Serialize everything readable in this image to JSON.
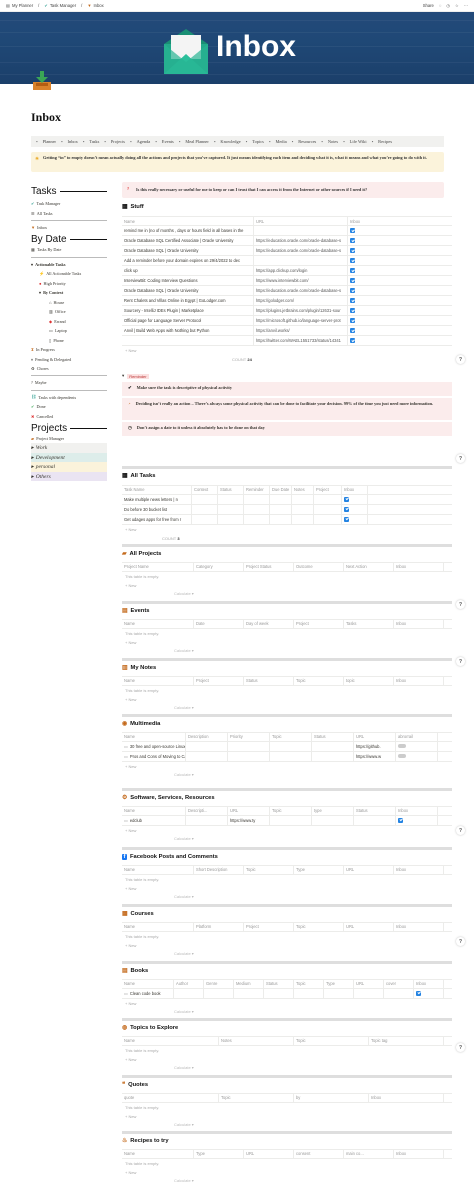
{
  "browser": {
    "crumbs": [
      "My Planner",
      "Task Manager",
      "Inbox"
    ],
    "share": "Share"
  },
  "page": {
    "title": "Inbox"
  },
  "nav": [
    "Planner",
    "Inbox",
    "Tasks",
    "Projects",
    "Agenda",
    "Events",
    "Meal Planner",
    "Knowledge",
    "Topics",
    "Media",
    "Resources",
    "Notes",
    "Life Wiki",
    "Recipes"
  ],
  "callout_top": "Getting “in” to empty doesn’t mean actually doing all the actions and projects that you’ve captured. It just means identifying each item and deciding what it is, what it means and what you’re going to do with it.",
  "callout_q": "Is this really necessary or useful for me to keep or can I trust that I can access it from the Internet or other sources if I need it?",
  "sidebar": {
    "tasks_h": "Tasks",
    "task_manager": "Task Manager",
    "all_tasks": "All Tasks",
    "inbox": "Inbox",
    "bydate_h": "By Date",
    "tasks_by_date": "Tasks By Date",
    "actionable": "Actionable Tasks",
    "all_actionable": "All Actionable Tasks",
    "high": "High Priority",
    "by_context": "By Context",
    "contexts": [
      "House",
      "Office",
      "Errand",
      "Laptop",
      "Phone"
    ],
    "in_progress": "In Progress",
    "pending": "Pending & Delegated",
    "chores": "Chores",
    "maybe": "Maybe",
    "deps": "Tasks with dependents",
    "done": "Done",
    "cancelled": "Cancelled",
    "projects_h": "Projects",
    "project_manager": "Project Manager",
    "areas": [
      "Work",
      "Development",
      "personal",
      "Others"
    ]
  },
  "stuff": {
    "title": "Stuff",
    "cols": [
      "Name",
      "URL",
      "Inbox"
    ],
    "rows": [
      [
        "remind me in (no of months , days or hours field in all bases in the",
        ""
      ],
      [
        "Oracle Database SQL Certified Associate | Oracle University",
        "https://education.oracle.com/oracle-database-s"
      ],
      [
        "Oracle Database SQL | Oracle University",
        "https://education.oracle.com/oracle-database-s"
      ],
      [
        "Add a reminder before your domain expires on 29/4/2022 to dec",
        ""
      ],
      [
        "click up",
        "https://app.clickup.com/login"
      ],
      [
        "InterviewBit: Coding Interview Questions",
        "https://www.interviewbit.com/"
      ],
      [
        "Oracle Database SQL | Oracle University",
        "https://education.oracle.com/oracle-database-s"
      ],
      [
        "Rent Chalets and Villas Online in Egypt | GoLodger.com",
        "https://golodger.com/"
      ],
      [
        "Sourcery - IntelliJ IDEs Plugin | Marketplace",
        "https://plugins.jetbrains.com/plugin/12631-sour"
      ],
      [
        "Official page for Language Server Protocol",
        "https://microsoft.github.io/language-server-prot"
      ],
      [
        "Anvil | Build Web Apps with Nothing but Python",
        "https://anvil.works/"
      ],
      [
        "",
        "https://twitter.com/WAEL1551733/status/14341"
      ]
    ],
    "count_label": "COUNT",
    "count": "24"
  },
  "reminder": {
    "tag": "Reminder",
    "items": [
      "Make sure the task is descriptive of physical activity",
      "Deciding isn’t really an action – There’s always some physical activity that can be done to facilitate your decision. 99% of the time you just need more information.",
      "Don’t assign a date to it unless it absolutely has to be done on that day"
    ]
  },
  "all_tasks": {
    "title": "All Tasks",
    "cols": [
      "Task Name",
      "Context",
      "Status",
      "Reminder",
      "Due Date",
      "Notes",
      "Project",
      "Inbox"
    ],
    "rows": [
      "Make multiple news letters | n",
      "Do before 30 bucket list",
      "Get udages apps for free from r"
    ],
    "count_label": "COUNT",
    "count": "3"
  },
  "empty": "This table is empty.",
  "new": "+ New",
  "calc": "Calculate ▾",
  "tables": [
    {
      "title": "All Projects",
      "cols": [
        "Project Name",
        "Category",
        "Project Status",
        "Outcome",
        "Next Action",
        "Inbox"
      ],
      "rows": []
    },
    {
      "title": "Events",
      "cols": [
        "Name",
        "Date",
        "Day of week",
        "Project",
        "Tasks",
        "Inbox"
      ],
      "rows": []
    },
    {
      "title": "My Notes",
      "cols": [
        "Name",
        "Project",
        "Status",
        "Topic",
        "topic",
        "Inbox"
      ],
      "rows": []
    },
    {
      "title": "Multimedia",
      "cols": [
        "Name",
        "Description",
        "Priority",
        "Topic",
        "Status",
        "URL",
        "abrorrail"
      ],
      "rows": [
        [
          "30 free and open-source Linux games - part 1 | Tr",
          "https://github."
        ],
        [
          "Pros and Cons of Moving to Calgary - How to Do",
          "https://www.w"
        ]
      ]
    },
    {
      "title": "Software, Services, Resources",
      "cols": [
        "Name",
        "Descripti...",
        "URL",
        "Topic",
        "type",
        "Status",
        "Inbox"
      ],
      "rows": [
        [
          "edclub",
          "https://www.ty"
        ]
      ]
    },
    {
      "title": "Facebook Posts and Comments",
      "cols": [
        "Name",
        "Short Description",
        "Topic",
        "Type",
        "URL",
        "Inbox"
      ],
      "rows": []
    },
    {
      "title": "Courses",
      "cols": [
        "Name",
        "Platform",
        "Project",
        "Topic",
        "URL",
        "Inbox"
      ],
      "rows": []
    },
    {
      "title": "Books",
      "cols": [
        "Name",
        "Author",
        "Genre",
        "Medium",
        "Status",
        "Topic",
        "Type",
        "URL",
        "cover",
        "Inbox"
      ],
      "rows": [
        [
          "Clean code book",
          ""
        ]
      ]
    },
    {
      "title": "Topics to Explore",
      "cols": [
        "Name",
        "Notes",
        "Topic",
        "Topic tag"
      ],
      "rows": []
    },
    {
      "title": "Quotes",
      "cols": [
        "quote",
        "Topic",
        "by",
        "Inbox"
      ],
      "rows": []
    },
    {
      "title": "Recipes to try",
      "cols": [
        "Name",
        "Type",
        "URL",
        "consent",
        "main co...",
        "Inbox"
      ],
      "rows": []
    }
  ],
  "colors": {
    "cover": "#1f4876",
    "accent": "#2383e2",
    "callout_pink": "#fbecec",
    "callout_yellow": "#fbf3db",
    "callout_grey": "#f1f1ef"
  }
}
